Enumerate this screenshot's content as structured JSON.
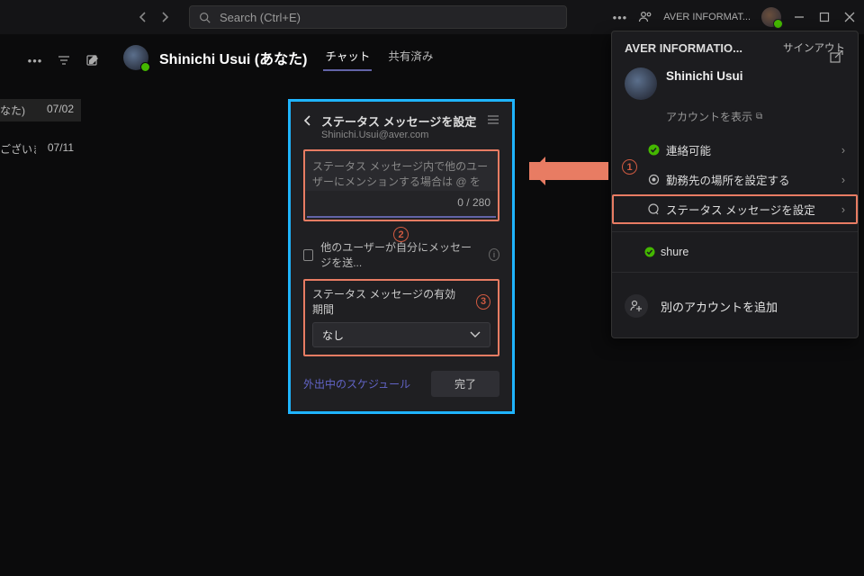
{
  "topbar": {
    "search_placeholder": "Search (Ctrl+E)",
    "org_short": "AVER INFORMAT..."
  },
  "subheader": {
    "title": "Shinichi Usui (あなた)",
    "tabs": {
      "chat": "チャット",
      "shared": "共有済み"
    }
  },
  "sidebar": {
    "row1_text": "なた)",
    "row1_date": "07/02",
    "row2_text": "ございます",
    "row2_date": "07/11"
  },
  "dialog": {
    "title": "ステータス メッセージを設定",
    "email": "Shinichi.Usui@aver.com",
    "textarea_placeholder": "ステータス メッセージ内で他のユーザーにメンションする場合は @ を入力します",
    "counter": "0 / 280",
    "checkbox_label": "他のユーザーが自分にメッセージを送...",
    "duration_label": "ステータス メッセージの有効期間",
    "duration_value": "なし",
    "schedule_link": "外出中のスケジュール",
    "done": "完了"
  },
  "account": {
    "org": "AVER INFORMATIO...",
    "signout": "サインアウト",
    "name": "Shinichi Usui",
    "show_account": "アカウントを表示",
    "items": {
      "available": "連絡可能",
      "location": "勤務先の場所を設定する",
      "status_msg": "ステータス メッセージを設定"
    },
    "other_org": "shure",
    "add_account": "別のアカウントを追加"
  },
  "callouts": {
    "n1": "1",
    "n2": "2",
    "n3": "3"
  }
}
